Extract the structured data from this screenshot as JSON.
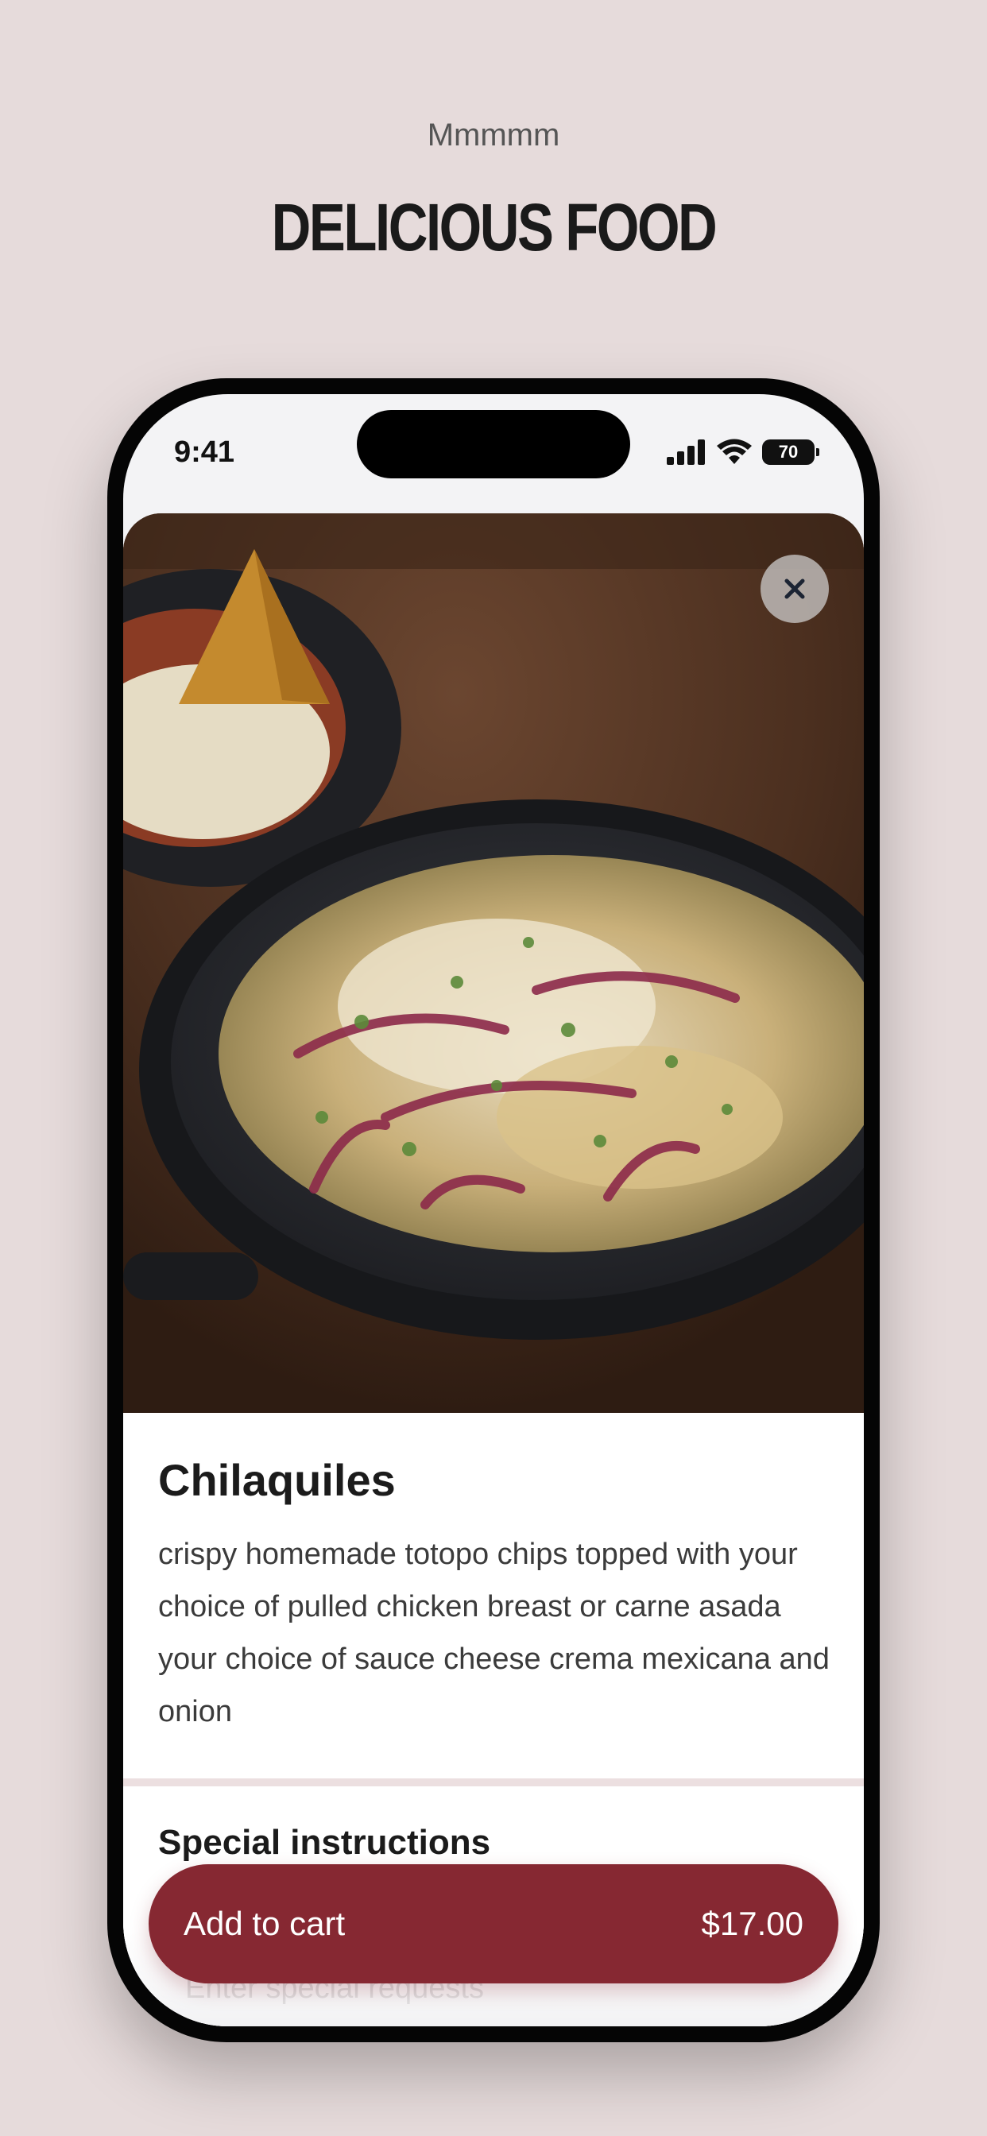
{
  "header": {
    "eyebrow": "Mmmmm",
    "headline": "Delicious Food"
  },
  "status_bar": {
    "time": "9:41",
    "battery": "70",
    "icons": [
      "cellular-signal-icon",
      "wifi-icon",
      "battery-icon"
    ]
  },
  "item": {
    "image_alt": "Chilaquiles in a dark speckled skillet topped with red onion, cilantro, cheese and crema",
    "close_icon": "close-icon",
    "title": "Chilaquiles",
    "description": "crispy homemade totopo chips topped with your choice of pulled chicken breast or carne asada your choice of sauce cheese crema mexicana and onion"
  },
  "special_instructions": {
    "title": "Special instructions",
    "placeholder": "Enter special requests"
  },
  "cart_button": {
    "label": "Add to cart",
    "price": "$17.00"
  },
  "colors": {
    "background": "#e6dbdb",
    "accent": "#862832",
    "divider": "#ecdfe0"
  }
}
